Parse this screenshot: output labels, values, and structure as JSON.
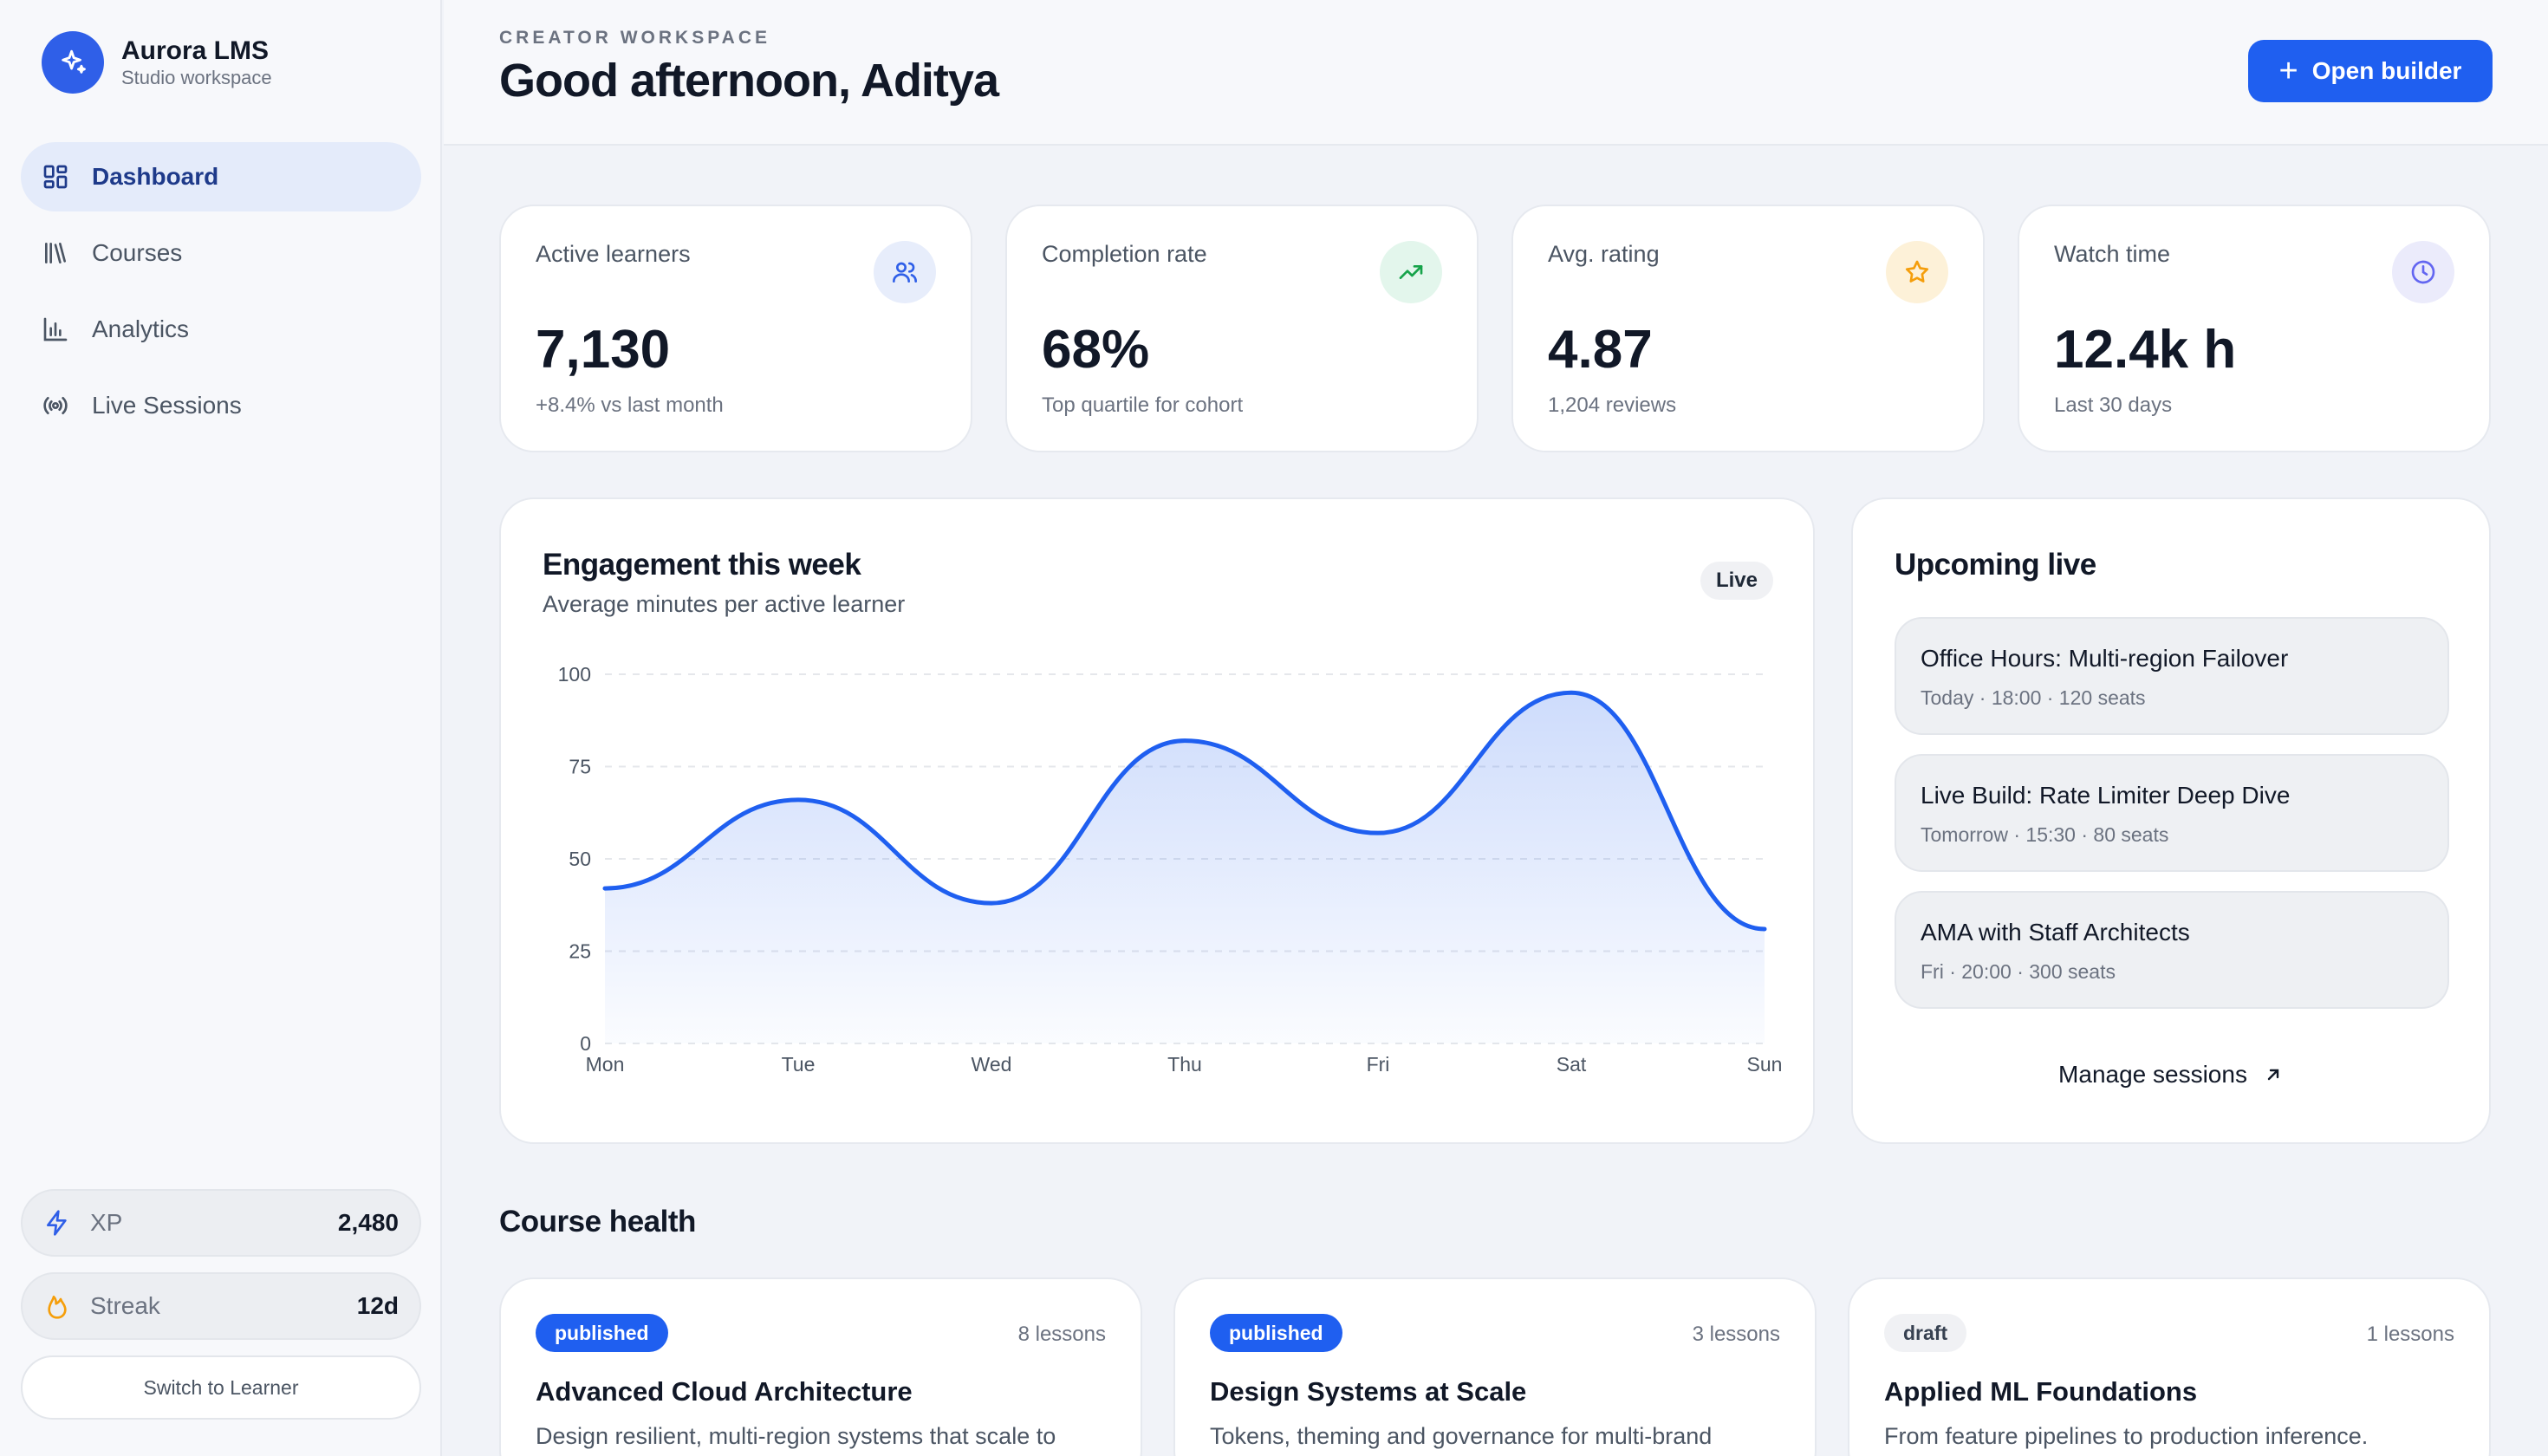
{
  "brand": {
    "name": "Aurora LMS",
    "subtitle": "Studio workspace"
  },
  "sidebar": {
    "items": [
      {
        "label": "Dashboard",
        "icon": "dashboard-icon",
        "active": true
      },
      {
        "label": "Courses",
        "icon": "library-icon",
        "active": false
      },
      {
        "label": "Analytics",
        "icon": "bar-chart-icon",
        "active": false
      },
      {
        "label": "Live Sessions",
        "icon": "broadcast-icon",
        "active": false
      }
    ],
    "xp": {
      "label": "XP",
      "value": "2,480",
      "icon": "lightning-icon"
    },
    "streak": {
      "label": "Streak",
      "value": "12d",
      "icon": "flame-icon"
    },
    "switch_label": "Switch to Learner"
  },
  "header": {
    "eyebrow": "CREATOR WORKSPACE",
    "greeting": "Good afternoon, Aditya",
    "primary_button": "Open builder"
  },
  "kpis": [
    {
      "label": "Active learners",
      "value": "7,130",
      "sub": "+8.4% vs last month",
      "icon": "users-icon",
      "color": "#2f5fe8"
    },
    {
      "label": "Completion rate",
      "value": "68%",
      "sub": "Top quartile for cohort",
      "icon": "trending-up-icon",
      "color": "#16a34a"
    },
    {
      "label": "Avg. rating",
      "value": "4.87",
      "sub": "1,204 reviews",
      "icon": "star-icon",
      "color": "#f59e0b"
    },
    {
      "label": "Watch time",
      "value": "12.4k h",
      "sub": "Last 30 days",
      "icon": "clock-icon",
      "color": "#6366f1"
    }
  ],
  "engagement": {
    "title": "Engagement this week",
    "subtitle": "Average minutes per active learner",
    "badge": "Live"
  },
  "chart_data": {
    "type": "area",
    "categories": [
      "Mon",
      "Tue",
      "Wed",
      "Thu",
      "Fri",
      "Sat",
      "Sun"
    ],
    "values": [
      42,
      66,
      38,
      82,
      57,
      95,
      31
    ],
    "yticks": [
      "0",
      "25",
      "50",
      "75",
      "100"
    ],
    "ylim": [
      0,
      100
    ],
    "grid": true,
    "line_color": "#1f5ff0"
  },
  "upcoming": {
    "title": "Upcoming live",
    "sessions": [
      {
        "title": "Office Hours: Multi-region Failover",
        "meta": "Today · 18:00 · 120 seats"
      },
      {
        "title": "Live Build: Rate Limiter Deep Dive",
        "meta": "Tomorrow · 15:30 · 80 seats"
      },
      {
        "title": "AMA with Staff Architects",
        "meta": "Fri · 20:00 · 300 seats"
      }
    ],
    "manage_label": "Manage sessions"
  },
  "course_health": {
    "title": "Course health",
    "courses": [
      {
        "status": "published",
        "lessons": "8 lessons",
        "title": "Advanced Cloud Architecture",
        "desc": "Design resilient, multi-region systems that scale to"
      },
      {
        "status": "published",
        "lessons": "3 lessons",
        "title": "Design Systems at Scale",
        "desc": "Tokens, theming and governance for multi-brand"
      },
      {
        "status": "draft",
        "lessons": "1 lessons",
        "title": "Applied ML Foundations",
        "desc": "From feature pipelines to production inference."
      }
    ]
  }
}
